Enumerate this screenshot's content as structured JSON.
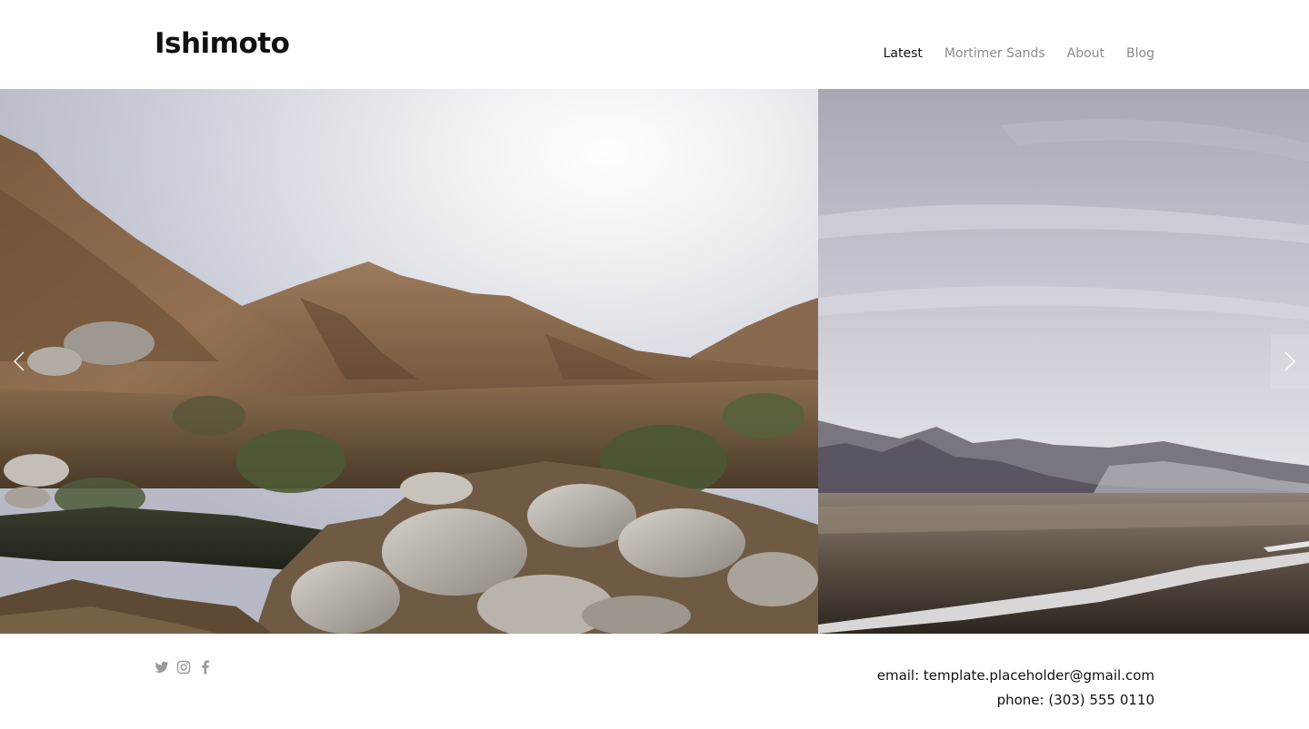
{
  "site": {
    "title": "Ishimoto"
  },
  "nav": {
    "items": [
      {
        "label": "Latest",
        "active": true
      },
      {
        "label": "Mortimer Sands",
        "active": false
      },
      {
        "label": "About",
        "active": false
      },
      {
        "label": "Blog",
        "active": false
      }
    ]
  },
  "gallery": {
    "slides": [
      {
        "icon": "landscape-photo-hills-rocks"
      },
      {
        "icon": "landscape-photo-valley-river"
      }
    ],
    "prev_icon": "chevron-left-icon",
    "next_icon": "chevron-right-icon"
  },
  "footer": {
    "social": [
      {
        "icon": "twitter-icon"
      },
      {
        "icon": "instagram-icon"
      },
      {
        "icon": "facebook-icon"
      }
    ],
    "email_line": "email: template.placeholder@gmail.com",
    "phone_line": "phone: (303) 555 0110"
  },
  "colors": {
    "text": "#111111",
    "nav_muted": "#8b8b8b",
    "icon_muted": "#9a9a9a",
    "background": "#ffffff"
  }
}
